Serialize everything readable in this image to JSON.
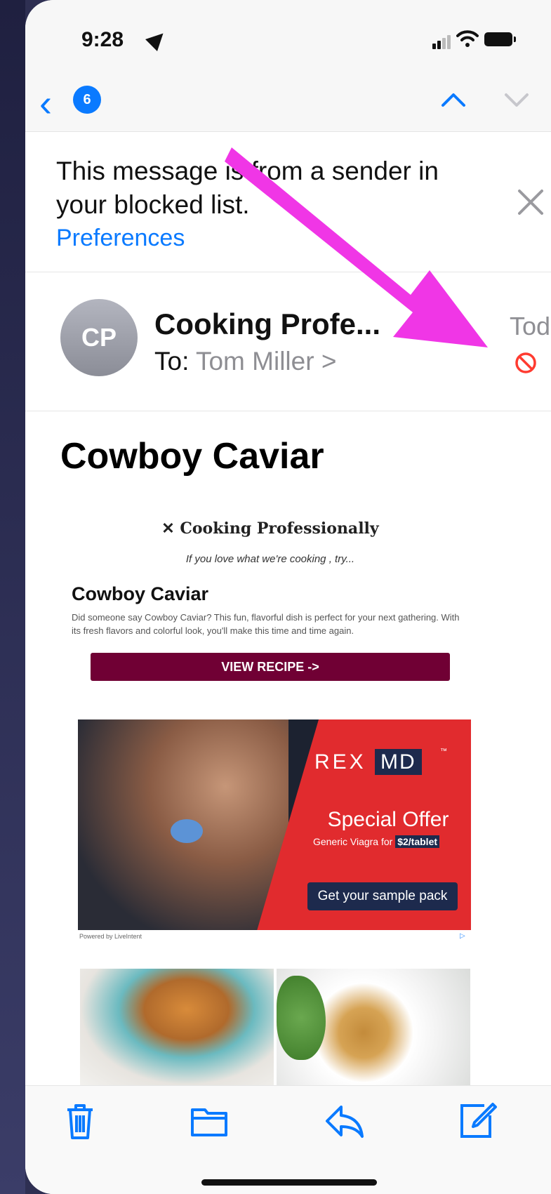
{
  "status": {
    "time": "9:28"
  },
  "nav": {
    "unread_count": "6"
  },
  "banner": {
    "message": "This message is from a sender in your blocked list.",
    "link": "Preferences"
  },
  "header": {
    "avatar_initials": "CP",
    "sender": "Cooking Profe...",
    "to_label": "To:",
    "to_name": "Tom Miller >",
    "date": "Today"
  },
  "subject": "Cowboy Caviar",
  "email": {
    "brand": "Cooking Professionally",
    "tagline": "If you love what we're cooking , try...",
    "recipe_title": "Cowboy Caviar",
    "recipe_desc": "Did someone say Cowboy Caviar? This fun, flavorful dish is perfect for your next gathering. With its fresh flavors and colorful look, you'll make this time and time again.",
    "view_button": "VIEW RECIPE ->"
  },
  "ad": {
    "logo_a": "REX",
    "logo_b": "MD",
    "tm": "™",
    "offer": "Special Offer",
    "sub_a": "Generic Viagra for ",
    "sub_price": "$2/tablet",
    "cta": "Get your sample pack",
    "powered": "Powered by LiveIntent"
  },
  "colors": {
    "accent": "#0a7aff",
    "button": "#700034",
    "ad_red": "#e12b2e",
    "arrow": "#f036e6",
    "block": "#ff3b30"
  },
  "icons": [
    "location-arrow-icon",
    "signal-icon",
    "wifi-icon",
    "battery-icon",
    "back-chevron-icon",
    "chevron-up-icon",
    "chevron-down-icon",
    "close-icon",
    "block-icon",
    "trash-icon",
    "folder-icon",
    "reply-icon",
    "compose-icon"
  ]
}
